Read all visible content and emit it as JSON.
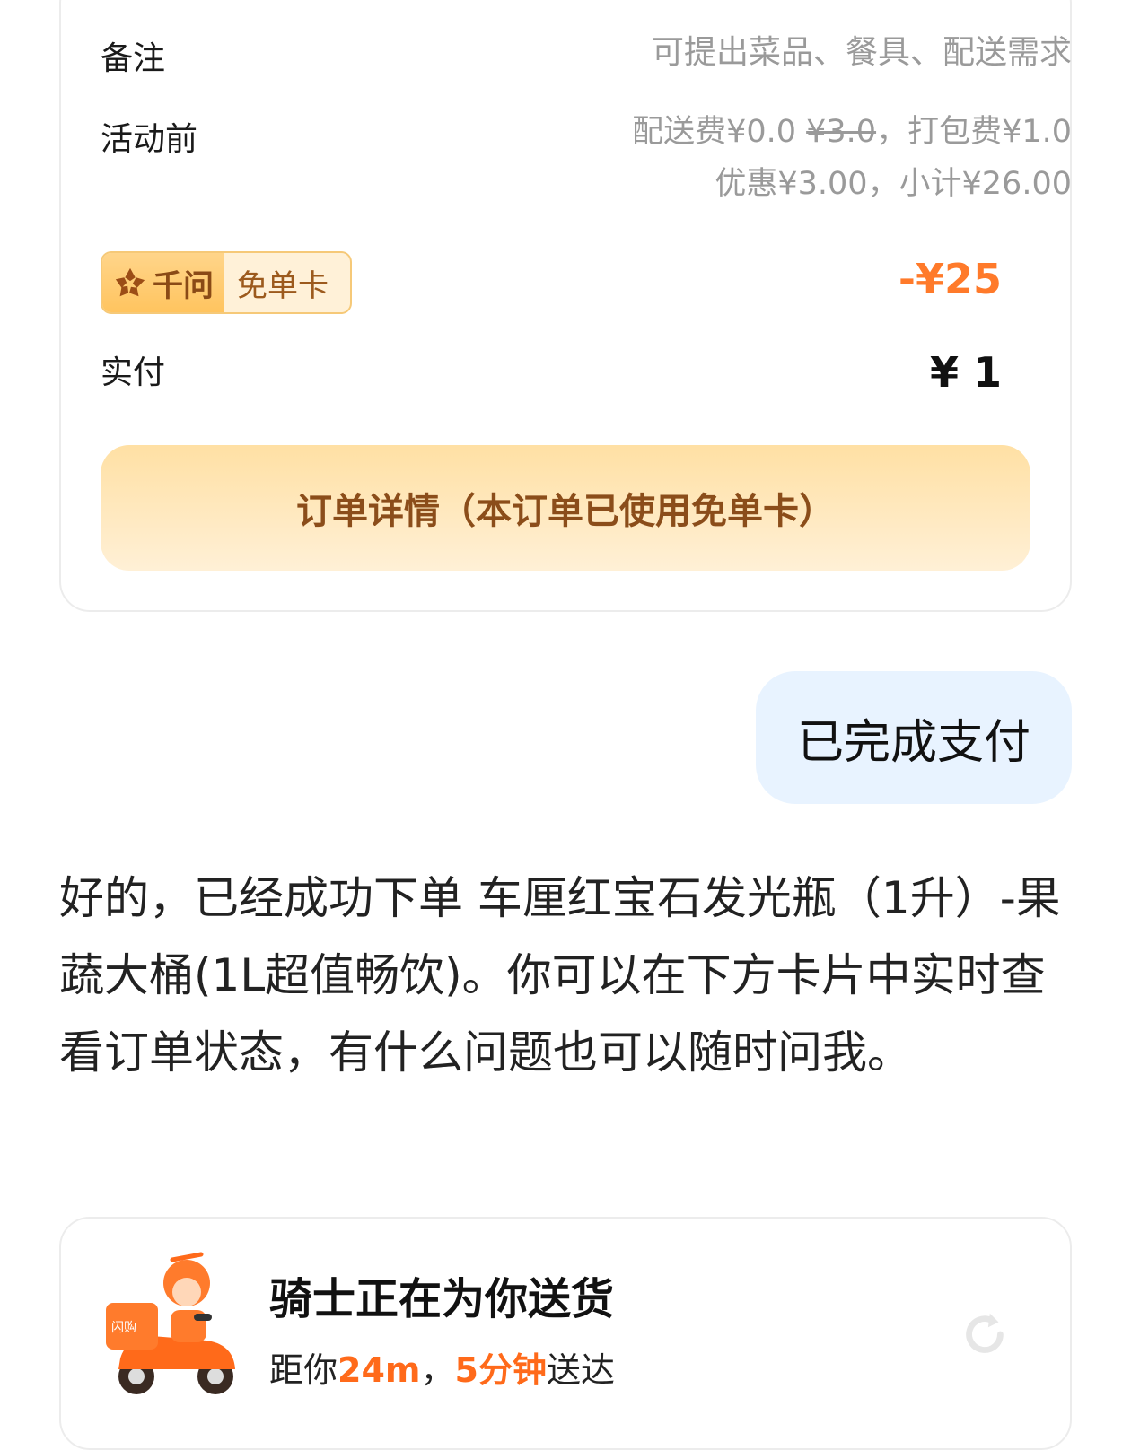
{
  "order_card": {
    "remark_label": "备注",
    "remark_placeholder": "可提出菜品、餐具、配送需求",
    "pre_activity_label": "活动前",
    "fee_prefix": "配送费¥0.0 ",
    "fee_original": "¥3.0",
    "fee_suffix": "，打包费¥1.0",
    "discount_line": "优惠¥3.00，小计¥26.00",
    "badge_brand": "千问",
    "badge_type": "免单卡",
    "badge_discount": "-¥25",
    "paid_label": "实付",
    "paid_amount": "¥ 1",
    "detail_button": "订单详情（本订单已使用免单卡）"
  },
  "user_message": "已完成支付",
  "assistant_reply": "好的，已经成功下单 车厘红宝石发光瓶（1升）-果蔬大桶(1L超值畅饮)。你可以在下方卡片中实时查看订单状态，有什么问题也可以随时问我。",
  "delivery": {
    "title": "骑士正在为你送货",
    "sub_prefix": "距你",
    "distance": "24m",
    "sep": "，",
    "eta": "5分钟",
    "sub_suffix": "送达",
    "scooter_brand": "闪购"
  },
  "colors": {
    "accent_orange": "#ff7a2a",
    "badge_brown": "#8b4d1a",
    "bubble_blue": "#e8f3ff"
  },
  "icons": [
    "qianwen-logo-icon",
    "rider-scooter-icon",
    "refresh-icon"
  ]
}
